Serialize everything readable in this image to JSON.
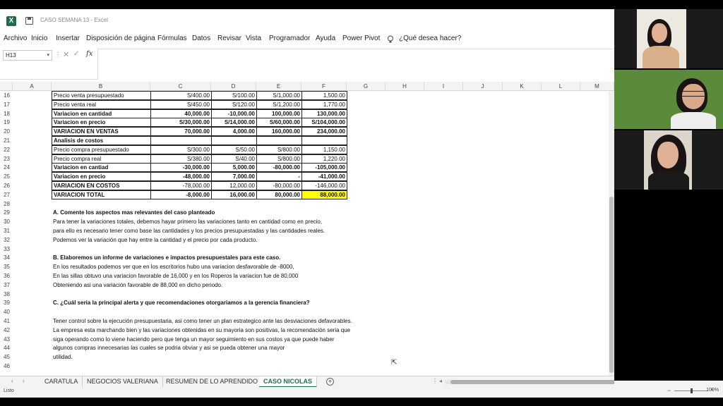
{
  "app": {
    "title": "CASO SEMANA 13  -  Excel"
  },
  "menu": [
    {
      "label": "Archivo"
    },
    {
      "label": "Inicio"
    },
    {
      "label": "Insertar"
    },
    {
      "label": "Disposición de página"
    },
    {
      "label": "Fórmulas"
    },
    {
      "label": "Datos"
    },
    {
      "label": "Revisar"
    },
    {
      "label": "Vista"
    },
    {
      "label": "Programador"
    },
    {
      "label": "Ayuda"
    },
    {
      "label": "Power Pivot"
    },
    {
      "label": "¿Qué desea hacer?"
    }
  ],
  "formula_bar": {
    "name_box": "H13",
    "fx": "fx",
    "value": ""
  },
  "columns": [
    "A",
    "B",
    "C",
    "D",
    "E",
    "F",
    "G",
    "H",
    "I",
    "J",
    "K",
    "L",
    "M"
  ],
  "table": [
    {
      "row": "16",
      "b": "Precio venta presupuestado",
      "c": "S/400.00",
      "d": "S/100.00",
      "e": "S/1,000.00",
      "f": "1,500.00",
      "bold": false
    },
    {
      "row": "17",
      "b": "Precio venta real",
      "c": "S/450.00",
      "d": "S/120.00",
      "e": "S/1,200.00",
      "f": "1,770.00",
      "bold": false
    },
    {
      "row": "18",
      "b": "Variacion en cantidad",
      "c": "40,000.00",
      "d": "-10,000.00",
      "e": "100,000.00",
      "f": "130,000.00",
      "bold": true
    },
    {
      "row": "19",
      "b": "Variacion en precio",
      "c": "S/30,000.00",
      "d": "S/14,000.00",
      "e": "S/60,000.00",
      "f": "S/104,000.00",
      "bold": true
    },
    {
      "row": "20",
      "b": "VARIACION EN VENTAS",
      "c": "70,000.00",
      "d": "4,000.00",
      "e": "160,000.00",
      "f": "234,000.00",
      "bold": true
    },
    {
      "row": "21",
      "b": "Analisis de costos",
      "c": "",
      "d": "",
      "e": "",
      "f": "",
      "bold": true
    },
    {
      "row": "22",
      "b": "Precio compra presupuestado",
      "c": "S/300.00",
      "d": "S/50.00",
      "e": "S/800.00",
      "f": "1,150.00",
      "bold": false
    },
    {
      "row": "23",
      "b": "Precio compra real",
      "c": "S/380.00",
      "d": "S/40.00",
      "e": "S/800.00",
      "f": "1,220.00",
      "bold": false
    },
    {
      "row": "24",
      "b": "Variacion en cantiad",
      "c": "-30,000.00",
      "d": "5,000.00",
      "e": "-80,000.00",
      "f": "-105,000.00",
      "bold": true
    },
    {
      "row": "25",
      "b": "Variacion en precio",
      "c": "-48,000.00",
      "d": "7,000.00",
      "e": "-",
      "f": "-41,000.00",
      "bold": true
    },
    {
      "row": "26",
      "b": "VARIACION EN COSTOS",
      "c": "-78,000.00",
      "d": "12,000.00",
      "e": "-80,000.00",
      "f": "-146,000.00",
      "bold": true,
      "b_only_bold": true
    },
    {
      "row": "27",
      "b": "VARIACION TOTAL",
      "c": "-8,000.00",
      "d": "16,000.00",
      "e": "80,000.00",
      "f": "88,000.00",
      "bold": true,
      "highlight_f": true
    }
  ],
  "highlight_color": "#ffff00",
  "rows_text": [
    {
      "row": "28",
      "text": "",
      "bold": false
    },
    {
      "row": "29",
      "text": "A. Comente los aspectos mas relevantes del caso planteado",
      "bold": true
    },
    {
      "row": "30",
      "text": "Para tener la variaciones totales, debemos hayar primero las variaciones tanto en cantidad como en precio,",
      "bold": false
    },
    {
      "row": "31",
      "text": "para ello es necesario tener como base las cantidades y los precios presupuestadas y las cantidades reales.",
      "bold": false
    },
    {
      "row": "32",
      "text": "Podemos ver la variación que hay entre la cantidad y el precio por cada producto.",
      "bold": false
    },
    {
      "row": "33",
      "text": "",
      "bold": false
    },
    {
      "row": "34",
      "text": "B. Elaboremos un informe de variaciones e impactos presupuestales para este caso.",
      "bold": true
    },
    {
      "row": "35",
      "text": "En los resultados podemos ver que en los escritorios hubo una variacion desfavorable de -8000,",
      "bold": false
    },
    {
      "row": "36",
      "text": "En las sillas obtuvo una variacion favorable de 16,000 y en los Roperos la variacion fue de 80,000",
      "bold": false
    },
    {
      "row": "37",
      "text": "Obteniendo asi una variación favorable de 88,000 en dicho periodo.",
      "bold": false
    },
    {
      "row": "38",
      "text": "",
      "bold": false
    },
    {
      "row": "39",
      "text": "C. ¿Cuál seria la principal alerta y que recomendaciones otorgariamos a la gerencia financiera?",
      "bold": true
    },
    {
      "row": "40",
      "text": "",
      "bold": false
    },
    {
      "row": "41",
      "text": "Tener control sobre la ejecución presupuestaria, asi como tener un plan estrategico ante las desviaciones defavorables.",
      "bold": false
    },
    {
      "row": "42",
      "text": "La empresa esta marchando bien y las variaciones obtenidas en su mayoria son positivas, la recomendación seria que",
      "bold": false
    },
    {
      "row": "43",
      "text": "siga operando como lo viene haciendo pero que tenga un mayor seguimiento en sus costos ya que puede haber",
      "bold": false
    },
    {
      "row": "44",
      "text": "algunos compras innecesarias las cuales se podria obviar y asi se pueda obtener una mayor",
      "bold": false
    },
    {
      "row": "45",
      "text": "utilidad.",
      "bold": false
    },
    {
      "row": "46",
      "text": "",
      "bold": false
    }
  ],
  "sheet_tabs": [
    {
      "label": "CARATULA",
      "active": false
    },
    {
      "label": "NEGOCIOS VALERIANA",
      "active": false
    },
    {
      "label": "RESUMEN DE LO APRENDIDO",
      "active": false
    },
    {
      "label": "CASO NICOLAS",
      "active": true
    }
  ],
  "status": {
    "mode": "Listo",
    "zoom": "100%"
  },
  "video_tiles": [
    {
      "name": "participant-1",
      "bg": "#e9e4dc"
    },
    {
      "name": "participant-2",
      "bg": "#5c8a3c"
    },
    {
      "name": "participant-3",
      "bg": "#d8d2c8"
    }
  ]
}
